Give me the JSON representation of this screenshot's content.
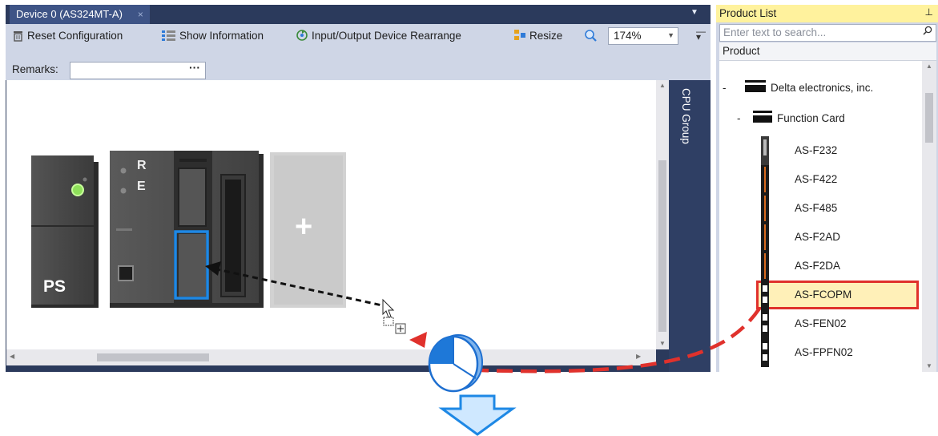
{
  "document_tab": {
    "title": "Device 0 (AS324MT-A)",
    "close_glyph": "×",
    "dropdown_icon": "chevron-down-icon"
  },
  "toolbar": {
    "reset_label": "Reset Configuration",
    "show_info_label": "Show Information",
    "io_rearrange_label": "Input/Output Device Rearrange",
    "resize_label": "Resize",
    "zoom_value": "174%"
  },
  "remarks": {
    "label": "Remarks:",
    "value": "",
    "ellipsis": "···"
  },
  "cpu_group": {
    "label": "CPU Group"
  },
  "modules": {
    "ps_label": "PS",
    "cpu_led_r": "R",
    "cpu_led_e": "E",
    "add_glyph": "+"
  },
  "product_list": {
    "title": "Product List",
    "pin_glyph": "⊥",
    "search_placeholder": "Enter text to search...",
    "column_header": "Product",
    "tree": {
      "vendor": {
        "toggle": "-",
        "label": "Delta electronics, inc."
      },
      "category": {
        "toggle": "-",
        "label": "Function Card"
      },
      "items": [
        "AS-F232",
        "AS-F422",
        "AS-F485",
        "AS-F2AD",
        "AS-F2DA",
        "AS-FCOPM",
        "AS-FEN02",
        "AS-FPFN02"
      ],
      "selected_item": "AS-FCOPM"
    }
  },
  "annotations": {
    "drag_arrow_color": "#111111",
    "flow_arrow_color": "#e0312c",
    "step_arrow_color": "#1e88e5",
    "slot_highlight_color": "#1e88e5"
  }
}
